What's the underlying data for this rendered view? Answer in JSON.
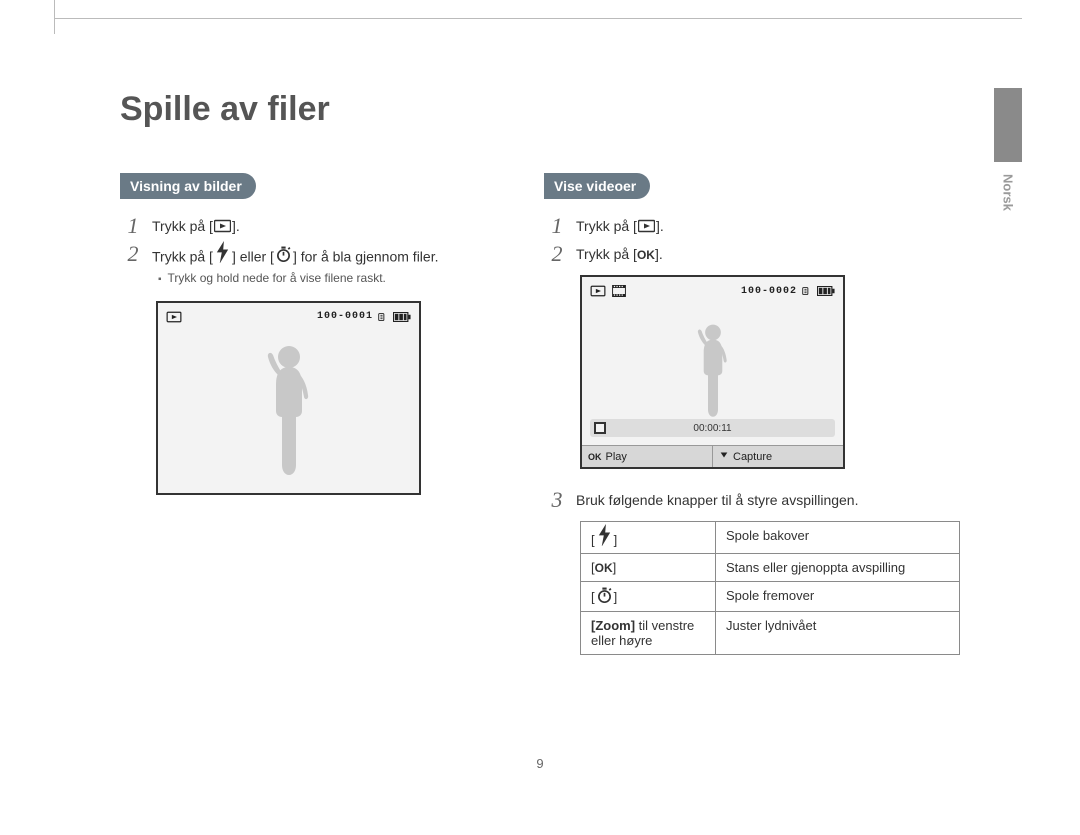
{
  "page": {
    "title": "Spille av filer",
    "language_tab": "Norsk",
    "number": "9"
  },
  "left": {
    "pill": "Visning av bilder",
    "steps": {
      "s1": {
        "num": "1",
        "pre": "Trykk på [",
        "post": "]."
      },
      "s2": {
        "num": "2",
        "pre": "Trykk på [",
        "mid": "] eller [",
        "post": "] for å bla gjennom filer."
      }
    },
    "sub": "Trykk og hold nede for å vise filene raskt.",
    "lcd": {
      "counter": "100-0001"
    }
  },
  "right": {
    "pill": "Vise videoer",
    "steps": {
      "s1": {
        "num": "1",
        "pre": "Trykk på [",
        "post": "]."
      },
      "s2": {
        "num": "2",
        "pre": "Trykk på [",
        "post": "]."
      },
      "s3": {
        "num": "3",
        "text": "Bruk følgende knapper til å styre avspillingen."
      }
    },
    "lcd": {
      "counter": "100-0002",
      "time": "00:00:11",
      "play_label": "Play",
      "capture_label": "Capture"
    },
    "table": {
      "r1": {
        "k_pre": "[",
        "k_post": "]",
        "v": "Spole bakover"
      },
      "r2": {
        "k_pre": "[",
        "k_post": "]",
        "v": "Stans eller gjenoppta avspilling"
      },
      "r3": {
        "k_pre": "[",
        "k_post": "]",
        "v": "Spole fremover"
      },
      "r4": {
        "k_lead": "[Zoom]",
        "k_rest": " til venstre eller høyre",
        "v": "Juster lydnivået"
      }
    }
  },
  "icons": {
    "ok": "OK"
  }
}
